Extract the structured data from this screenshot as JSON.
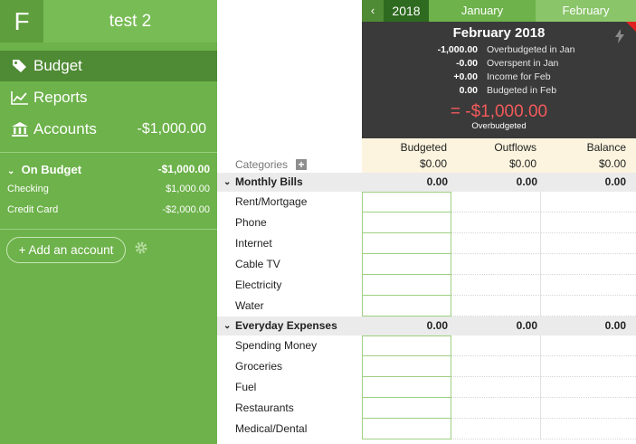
{
  "app": {
    "logo_letter": "F",
    "budget_name": "test 2"
  },
  "nav": {
    "budget": "Budget",
    "reports": "Reports",
    "accounts": "Accounts",
    "accounts_total": "-$1,000.00"
  },
  "on_budget": {
    "label": "On Budget",
    "total": "-$1,000.00",
    "accounts": [
      {
        "name": "Checking",
        "balance": "$1,000.00"
      },
      {
        "name": "Credit Card",
        "balance": "-$2,000.00"
      }
    ]
  },
  "add_account_label": "+ Add an account",
  "months": {
    "year": "2018",
    "prev_symbol": "‹",
    "items": [
      "January",
      "February"
    ]
  },
  "summary": {
    "title": "February 2018",
    "lines": [
      {
        "value": "-1,000.00",
        "label": "Overbudgeted in Jan"
      },
      {
        "value": "-0.00",
        "label": "Overspent in Jan"
      },
      {
        "value": "+0.00",
        "label": "Income for Feb"
      },
      {
        "value": "0.00",
        "label": "Budgeted in Feb"
      }
    ],
    "total": "= -$1,000.00",
    "total_label": "Overbudgeted"
  },
  "columns": {
    "categories": "Categories",
    "budgeted": {
      "label": "Budgeted",
      "total": "$0.00"
    },
    "outflows": {
      "label": "Outflows",
      "total": "$0.00"
    },
    "balance": {
      "label": "Balance",
      "total": "$0.00"
    }
  },
  "groups": [
    {
      "name": "Monthly Bills",
      "budgeted": "0.00",
      "outflows": "0.00",
      "balance": "0.00",
      "categories": [
        "Rent/Mortgage",
        "Phone",
        "Internet",
        "Cable TV",
        "Electricity",
        "Water"
      ]
    },
    {
      "name": "Everyday Expenses",
      "budgeted": "0.00",
      "outflows": "0.00",
      "balance": "0.00",
      "categories": [
        "Spending Money",
        "Groceries",
        "Fuel",
        "Restaurants",
        "Medical/Dental"
      ]
    }
  ],
  "colors": {
    "sidebar": "#6db24a",
    "sidebar_active": "#4f8a34",
    "summary_bg": "#3a3a3a",
    "overbudget": "#f35a5a",
    "header_bg": "#fcf4de"
  }
}
